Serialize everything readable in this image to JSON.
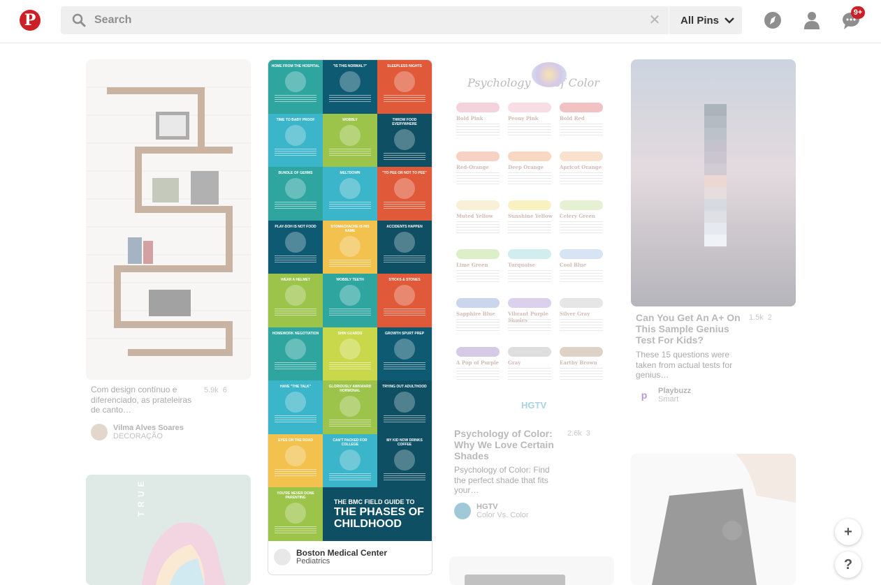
{
  "header": {
    "logo_letter": "P",
    "search": {
      "placeholder": "Search",
      "value": ""
    },
    "scope_label": "All Pins",
    "notifications_badge": "9+"
  },
  "pins": [
    {
      "id": "shelves",
      "description": "Com design contínuo e diferenciado, as prateleiras de canto…",
      "repins": "5.9k",
      "likes": "6",
      "user": "Vilma Alves Soares",
      "board": "DECORAÇÃO"
    },
    {
      "id": "childhood",
      "user": "Boston Medical Center",
      "board": "Pediatrics",
      "mosaic_phases": [
        "HOME FROM THE HOSPITAL",
        "\"IS THIS NORMAL?\"",
        "SLEEPLESS NIGHTS",
        "TIME TO BABY PROOF",
        "WOBBLY",
        "THROW FOOD EVERYWHERE",
        "BUNDLE OF GERMS",
        "MELTDOWN",
        "\"TO PEE OR NOT TO PEE\"",
        "PLAY-DOH IS NOT FOOD",
        "STOMACHACHE IS HIS NAME",
        "ACCIDENTS HAPPEN",
        "WEAR A HELMET",
        "WOBBLY TEETH",
        "STICKS & STONES",
        "HOMEWORK NEGOTIATION",
        "SHIN GUARDS",
        "GROWTH SPURT PREP",
        "HAVE \"THE TALK\"",
        "GLORIOUSLY AWKWARD HORMONAL",
        "TRYING OUT ADULTHOOD",
        "EYES ON THE ROAD",
        "CAN'T PACKED FOR COLLEGE",
        "MY KID NOW DRINKS COFFEE",
        "YOU'RE NEVER DONE PARENTING"
      ],
      "mosaic_title_small": "THE BMC FIELD GUIDE TO",
      "mosaic_title_big": "THE PHASES OF CHILDHOOD"
    },
    {
      "id": "psychology",
      "image_title_1": "Psychology",
      "image_title_2": "of Color",
      "image_brand": "HGTV",
      "swatches": [
        {
          "name": "Bold Pink",
          "color": "#e8a0b5"
        },
        {
          "name": "Peony Pink",
          "color": "#f0b6c6"
        },
        {
          "name": "Bold Red",
          "color": "#e07a7a"
        },
        {
          "name": "Red-Orange",
          "color": "#f09a80"
        },
        {
          "name": "Deep Orange",
          "color": "#f2a97c"
        },
        {
          "name": "Apricot Orange",
          "color": "#f4be94"
        },
        {
          "name": "Muted Yellow",
          "color": "#f0e0a8"
        },
        {
          "name": "Sunshine Yellow",
          "color": "#f4e27a"
        },
        {
          "name": "Celery Green",
          "color": "#c9e0a0"
        },
        {
          "name": "Lime Green",
          "color": "#b5dc8a"
        },
        {
          "name": "Turquoise",
          "color": "#9ad8d8"
        },
        {
          "name": "Cool Blue",
          "color": "#a8c4e8"
        },
        {
          "name": "Sapphire Blue",
          "color": "#8da4d4"
        },
        {
          "name": "Vibrant Purple Shades",
          "color": "#b09ad6"
        },
        {
          "name": "Silver Gray",
          "color": "#c8c8cc"
        },
        {
          "name": "A Pop of Purple",
          "color": "#a68ec8"
        },
        {
          "name": "Gray",
          "color": "#b8b8b8"
        },
        {
          "name": "Earthy Brown",
          "color": "#b89a80"
        }
      ],
      "title": "Psychology of Color: Why We Love Certain Shades",
      "description": "Psychology of Color: Find the perfect shade that fits your…",
      "repins": "2.6k",
      "likes": "3",
      "user": "HGTV",
      "board": "Color Vs. Color"
    },
    {
      "id": "genius",
      "title": "Can You Get An A+ On This Sample Genius Test For Kids?",
      "description": "These 15 questions were taken from actual tests for genius…",
      "repins": "1.5k",
      "likes": "2",
      "user": "Playbuzz",
      "board": "Smart"
    },
    {
      "id": "art",
      "image_text": "TRUE"
    }
  ],
  "fabs": {
    "add_label": "+",
    "help_label": "?"
  },
  "colors": {
    "brand": "#cb2027",
    "phase_tiles": [
      "#2fa5a0",
      "#0f5a73",
      "#e05a3a",
      "#3bb5c9",
      "#9cc44a",
      "#0f4f64",
      "#2fa5a0",
      "#3bb5c9",
      "#e05a3a",
      "#0f5a73",
      "#f2c14e",
      "#0f4f64",
      "#9cc44a",
      "#2fa5a0",
      "#e05a3a",
      "#2fa5a0",
      "#c9d84a",
      "#0f5a73",
      "#3bb5c9",
      "#9cc44a",
      "#0f4f64",
      "#f2c14e",
      "#3bb5c9",
      "#0f4f64",
      "#9cc44a"
    ]
  }
}
